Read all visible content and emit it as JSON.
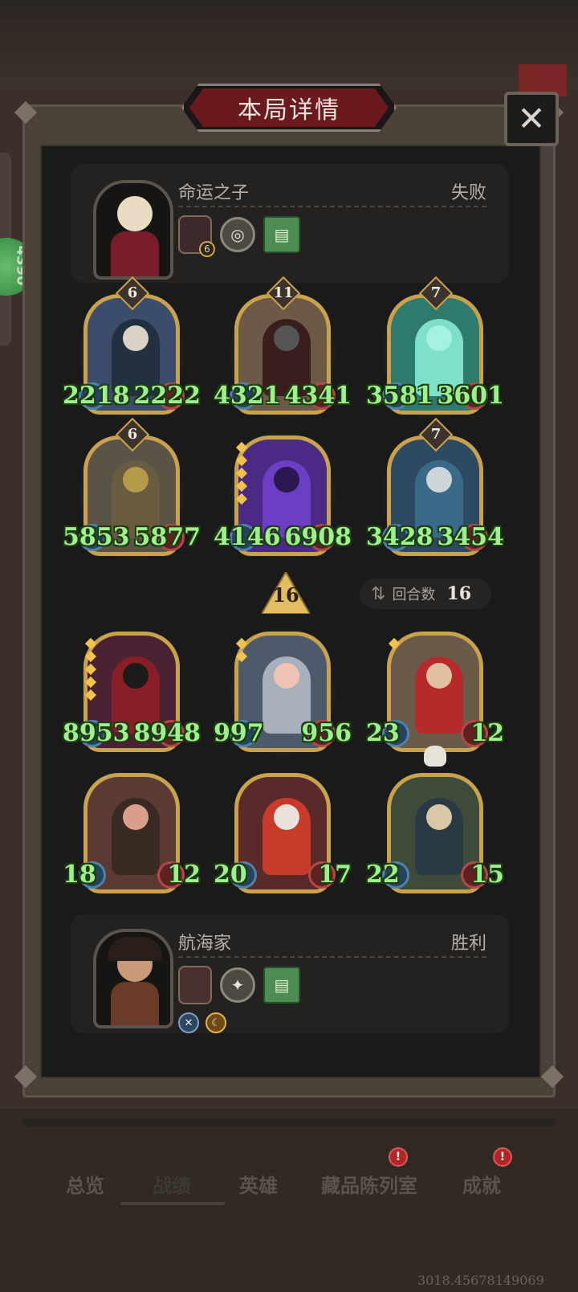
{
  "title": "本局详情",
  "close_glyph": "✕",
  "side_badge": "4390",
  "opponent": {
    "name": "命运之子",
    "result": "失败",
    "hero_level": "6"
  },
  "player": {
    "name": "航海家",
    "result": "胜利"
  },
  "turn": {
    "marker": "16",
    "rounds_label": "回合数",
    "rounds_value": "16"
  },
  "enemy_units": [
    {
      "tier": "6",
      "atk": "2218",
      "hp": "2222",
      "color": "#3c4d6c"
    },
    {
      "tier": "11",
      "atk": "4321",
      "hp": "4341",
      "color": "#6d5a46"
    },
    {
      "tier": "7",
      "atk": "3581",
      "hp": "3601",
      "color": "#2e7a6c"
    },
    {
      "tier": "6",
      "atk": "5853",
      "hp": "5877",
      "color": "#5a5446"
    },
    {
      "tier": "",
      "atk": "4146",
      "hp": "6908",
      "color": "#4b2a86"
    },
    {
      "tier": "7",
      "atk": "3428",
      "hp": "3454",
      "color": "#2e4a62"
    }
  ],
  "player_units": [
    {
      "atk": "8953",
      "hp": "8948",
      "color": "#4a2233"
    },
    {
      "atk": "997",
      "hp": "956",
      "color": "#4c5a6c"
    },
    {
      "atk": "23",
      "hp": "12",
      "color": "#6a5a4a"
    },
    {
      "atk": "18",
      "hp": "12",
      "color": "#5b3a33"
    },
    {
      "atk": "20",
      "hp": "17",
      "color": "#5a2a2a"
    },
    {
      "atk": "22",
      "hp": "15",
      "color": "#3e4a3a"
    }
  ],
  "nav": {
    "overview": "总览",
    "records": "战绩",
    "heroes": "英雄",
    "collection": "藏品陈列室",
    "achievements": "成就",
    "notice": "!"
  },
  "uid": "3018.45678149069",
  "icons": {
    "close": "close-icon",
    "coin": "coin-icon",
    "book": "book-icon",
    "swap": "swap-icon",
    "skull": "skull-icon"
  },
  "colors": {
    "stat_green": "#9df08d",
    "gold_border": "#c9a24e",
    "title_red": "#6a1a1c"
  }
}
